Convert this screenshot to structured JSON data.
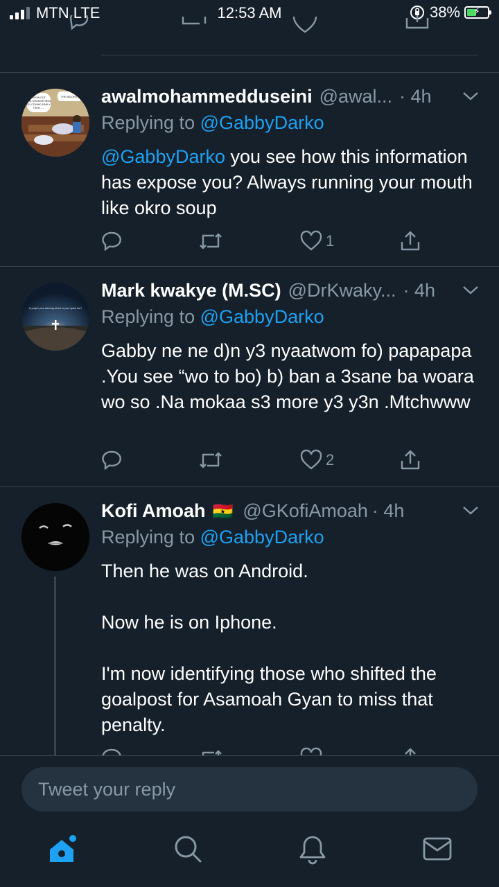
{
  "status_bar": {
    "carrier": "MTN LTE",
    "time": "12:53 AM",
    "battery": "38%",
    "battery_level": 0.38
  },
  "tweets": [
    {
      "name": "awalmohammedduseini",
      "handle": "@awal...",
      "time": "· 4h",
      "replying_prefix": "Replying to",
      "replying_to": "@GabbyDarko",
      "mention": "@GabbyDarko",
      "text": " you see how this information has expose you? Always running your mouth like okro soup",
      "likes": "1",
      "avatar_caption_lines": [
        "KNOW GOT",
        "THE SPEAKER SEAT",
        "BY COMING EARLY",
        "THEN ......",
        "THE MAJORITY"
      ]
    },
    {
      "name": "Mark kwakye (M.SC)",
      "handle": "@DrKwaky...",
      "time": "· 4h",
      "replying_prefix": "Replying to",
      "replying_to": "@GabbyDarko",
      "text": "Gabby ne ne d)n y3 nyaatwom fo) papapapa .You see “wo to bo) b) ban a 3sane ba woara wo so .Na mokaa s3 more y3 y3n .Mtchwww",
      "likes": "2",
      "avatar_caption": "Is prayer your steering wheel or your spare tire?"
    },
    {
      "name": "Kofi Amoah",
      "flag": "🇬🇭",
      "handle": "@GKofiAmoah",
      "time": "· 4h",
      "replying_prefix": "Replying to",
      "replying_to": "@GabbyDarko",
      "text": "Then he was on Android.\n\nNow he is on Iphone.\n\nI'm now identifying those who shifted the goalpost for Asamoah Gyan to miss that penalty."
    }
  ],
  "reply_bar": {
    "placeholder": "Tweet your reply"
  },
  "tab_bar": {
    "items": [
      "home-icon",
      "search-icon",
      "notifications-icon",
      "messages-icon"
    ],
    "accent": "#1da1f2"
  },
  "colors": {
    "background": "#15202b",
    "secondary": "#8899a6",
    "link": "#1da1f2",
    "divider": "#38444d"
  }
}
